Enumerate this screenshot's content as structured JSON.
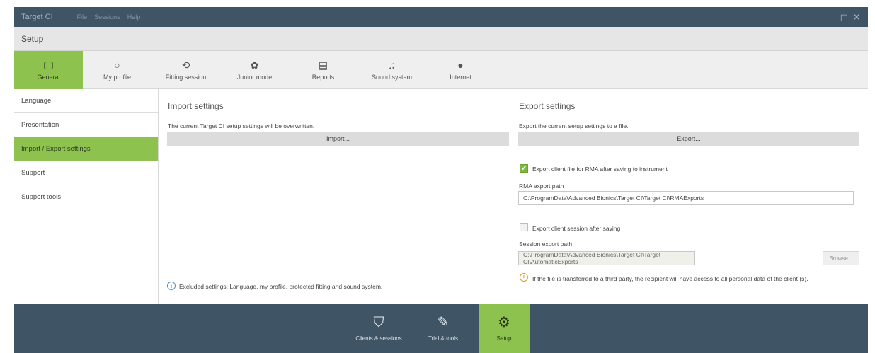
{
  "window": {
    "app_title": "Target CI",
    "menu": [
      "File",
      "Sessions",
      "Help"
    ],
    "controls": [
      "–",
      "◻",
      "✕"
    ]
  },
  "header": {
    "title": "Setup"
  },
  "toolbar": {
    "tabs": [
      {
        "label": "General",
        "icon": "monitor-icon",
        "glyph": "🖵"
      },
      {
        "label": "My profile",
        "icon": "profile-icon",
        "glyph": "○"
      },
      {
        "label": "Fitting session",
        "icon": "fitting-icon",
        "glyph": "⟲"
      },
      {
        "label": "Junior mode",
        "icon": "junior-icon",
        "glyph": "✿"
      },
      {
        "label": "Reports",
        "icon": "report-icon",
        "glyph": "▤"
      },
      {
        "label": "Sound system",
        "icon": "music-icon",
        "glyph": "♫"
      },
      {
        "label": "Internet",
        "icon": "globe-icon",
        "glyph": "●"
      }
    ]
  },
  "sidebar": {
    "items": [
      {
        "label": "Language"
      },
      {
        "label": "Presentation"
      },
      {
        "label": "Import / Export settings"
      },
      {
        "label": "Support"
      },
      {
        "label": "Support tools"
      }
    ]
  },
  "import": {
    "title": "Import settings",
    "description": "The current Target CI setup settings will be overwritten.",
    "button": "Import...",
    "note": "Excluded settings: Language, my profile, protected fitting and sound system."
  },
  "export": {
    "title": "Export settings",
    "description": "Export the current setup settings to a file.",
    "button": "Export...",
    "rma_checkbox_label": "Export client file for RMA after saving to instrument",
    "rma_path_label": "RMA export path",
    "rma_path_value": "C:\\ProgramData\\Advanced Bionics\\Target CI\\Target CI\\RMAExports",
    "session_checkbox_label": "Export client session after saving",
    "session_path_label": "Session export path",
    "session_path_value": "C:\\ProgramData\\Advanced Bionics\\Target CI\\Target CI\\AutomaticExports",
    "browse_button": "Browse...",
    "warning": "If the file is transferred to a third party, the recipient will have access to all personal data of the client (s)."
  },
  "bottom_nav": {
    "items": [
      {
        "label": "Clients & sessions",
        "glyph": "⛉"
      },
      {
        "label": "Trial & tools",
        "glyph": "✎"
      },
      {
        "label": "Setup",
        "glyph": "⚙"
      }
    ]
  },
  "colors": {
    "accent": "#8dc24f",
    "frame": "#3f5566"
  }
}
